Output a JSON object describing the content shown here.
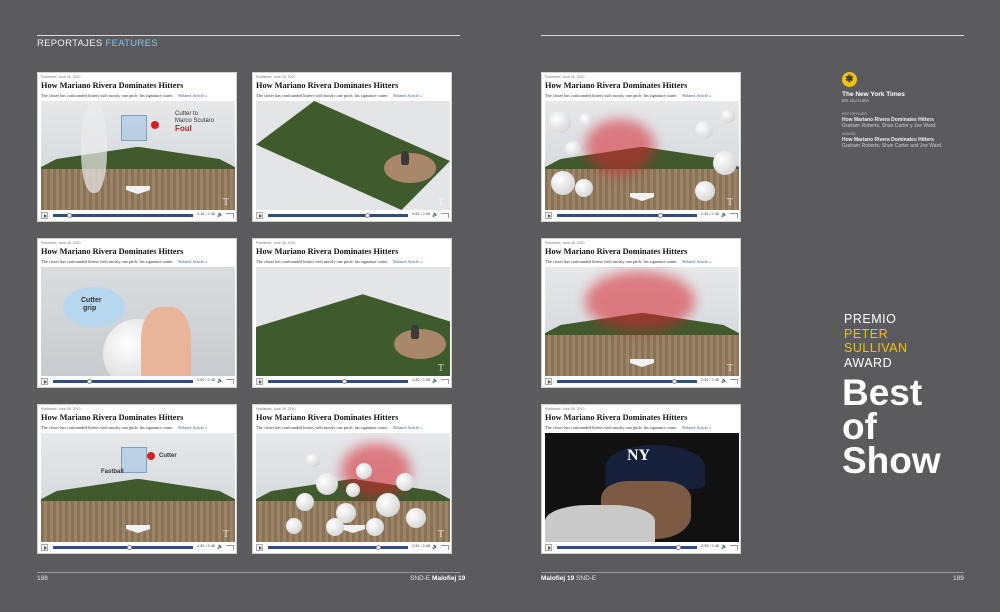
{
  "header": {
    "section_es": "REPORTAJES",
    "section_en": "FEATURES"
  },
  "card": {
    "published": "Published: June 26, 2010",
    "title": "How Mariano Rivera Dominates Hitters",
    "subtitle": "The closer has confounded hitters with mostly one pitch: his signature cutter.",
    "related": "Related Article »",
    "nyt_mark": "T",
    "volume_icon": "speaker-icon"
  },
  "cards": [
    {
      "time": "0:18 / 2:48",
      "progress": 0.1,
      "labels": [
        "Cutter to",
        "Marco Scutaro",
        "Foul"
      ]
    },
    {
      "time": "0:55 / 2:48",
      "progress": 0.72,
      "labels": []
    },
    {
      "time": "0:50 / 2:48",
      "progress": 0.25,
      "labels": [
        "Cutter",
        "grip"
      ]
    },
    {
      "time": "1:30 / 2:48",
      "progress": 0.55,
      "labels": []
    },
    {
      "time": "1:30 / 2:48",
      "progress": 0.55,
      "labels": [
        "Cutter",
        "Fastball"
      ]
    },
    {
      "time": "2:30 / 2:48",
      "progress": 0.8,
      "labels": []
    },
    {
      "time": "2:35 / 2:48",
      "progress": 0.75,
      "labels": []
    },
    {
      "time": "2:39 / 2:48",
      "progress": 0.85,
      "labels": []
    },
    {
      "time": "2:39 / 2:48",
      "progress": 0.88,
      "labels": []
    }
  ],
  "credits": {
    "icon": "asterisk-icon",
    "publication": "The New York Times",
    "location": "EE.UU./USA",
    "label_es": "REPORTAJES",
    "headline_es": "How Mariano Rivera Dominates Hitters",
    "names_es": "Graham Roberts, Shan Carter y Joe Ward.",
    "label_en": "AWARD",
    "headline_en": "How Mariano Rivera Dominates Hitters",
    "names_en": "Graham Roberts, Shan Carter and Joe Ward."
  },
  "award": {
    "premio": "PREMIO",
    "peter": "PETER",
    "sullivan": "SULLIVAN",
    "award": "AWARD",
    "best": "Best",
    "of": "of",
    "show": "Show"
  },
  "footer": {
    "left_page": "188",
    "left_pub": "SND-E",
    "left_mag": "Malofiej 19",
    "right_mag": "Malofiej 19",
    "right_pub": "SND-E",
    "right_page": "189"
  }
}
